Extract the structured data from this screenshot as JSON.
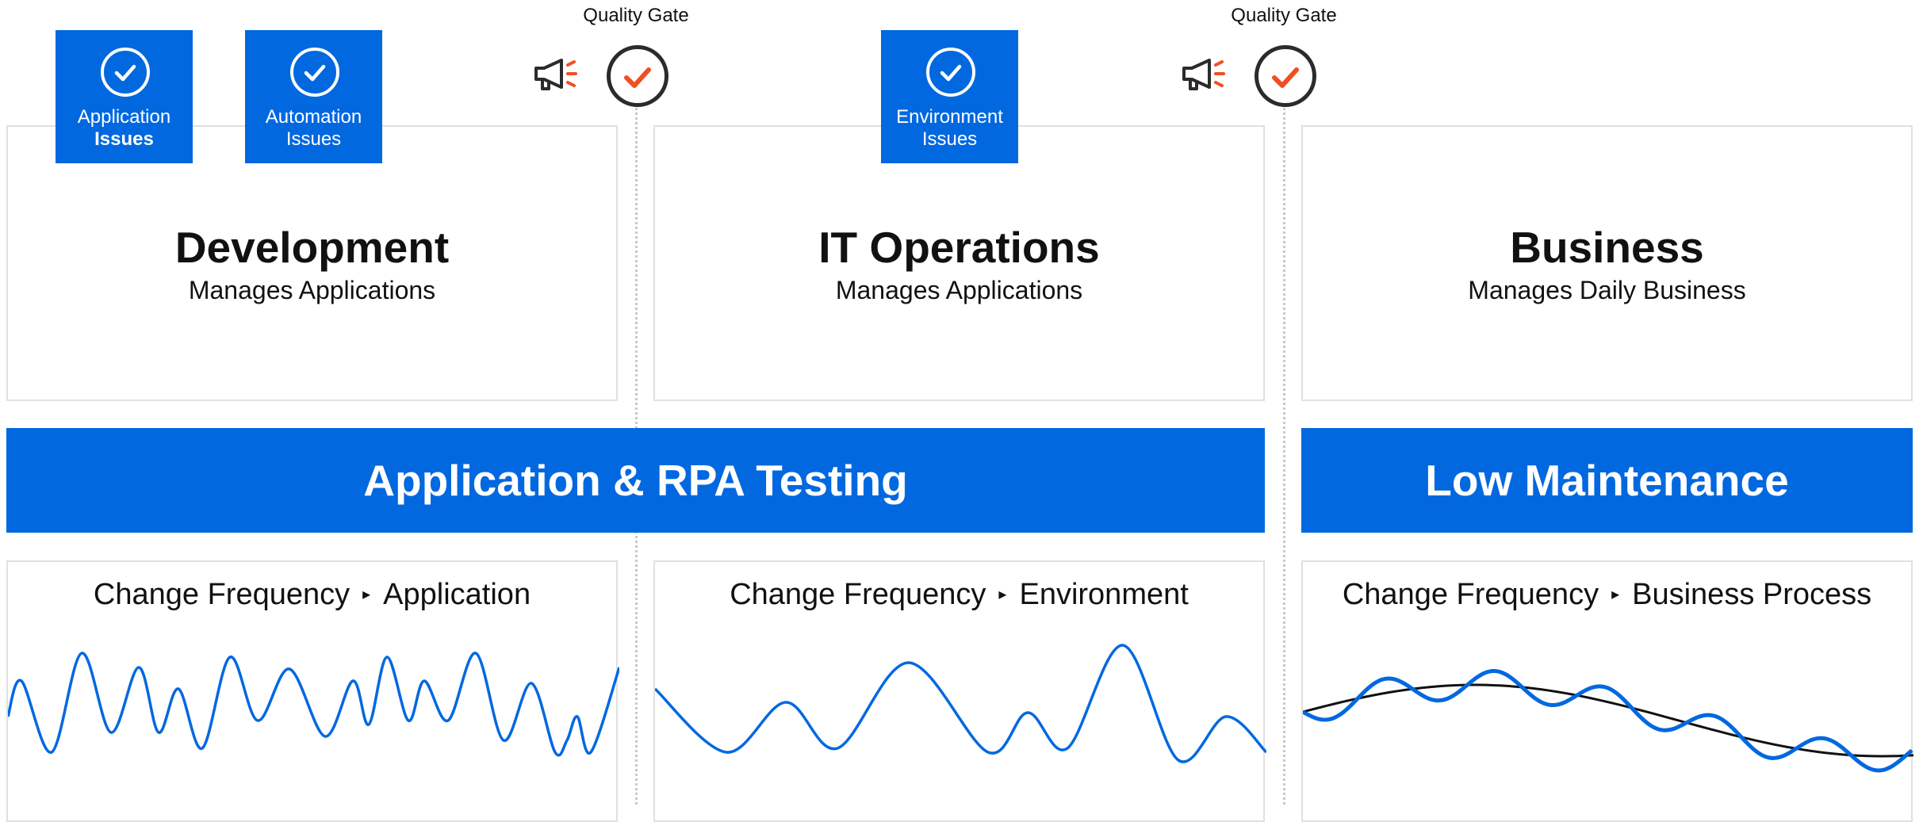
{
  "quality_gates": [
    {
      "label": "Quality Gate"
    },
    {
      "label": "Quality Gate"
    }
  ],
  "issue_tiles": [
    {
      "line1": "Application",
      "line2": "Issues",
      "icon": "check-circle-icon"
    },
    {
      "line1": "Automation",
      "line2": "Issues",
      "icon": "check-circle-icon"
    },
    {
      "line1": "Environment",
      "line2": "Issues",
      "icon": "check-circle-icon"
    }
  ],
  "cards": [
    {
      "title": "Development",
      "subtitle": "Manages Applications"
    },
    {
      "title": "IT Operations",
      "subtitle": "Manages Applications"
    },
    {
      "title": "Business",
      "subtitle": "Manages Daily Business"
    }
  ],
  "banners": [
    {
      "label": "Application & RPA Testing"
    },
    {
      "label": "Low Maintenance"
    }
  ],
  "frequency_panels": [
    {
      "prefix": "Change Frequency",
      "arrow": "▸",
      "target": "Application"
    },
    {
      "prefix": "Change Frequency",
      "arrow": "▸",
      "target": "Environment"
    },
    {
      "prefix": "Change Frequency",
      "arrow": "▸",
      "target": "Business Process"
    }
  ],
  "colors": {
    "accent_blue": "#0268e0",
    "alert_orange": "#f04e23",
    "gate_ring": "#2b2b2b"
  }
}
